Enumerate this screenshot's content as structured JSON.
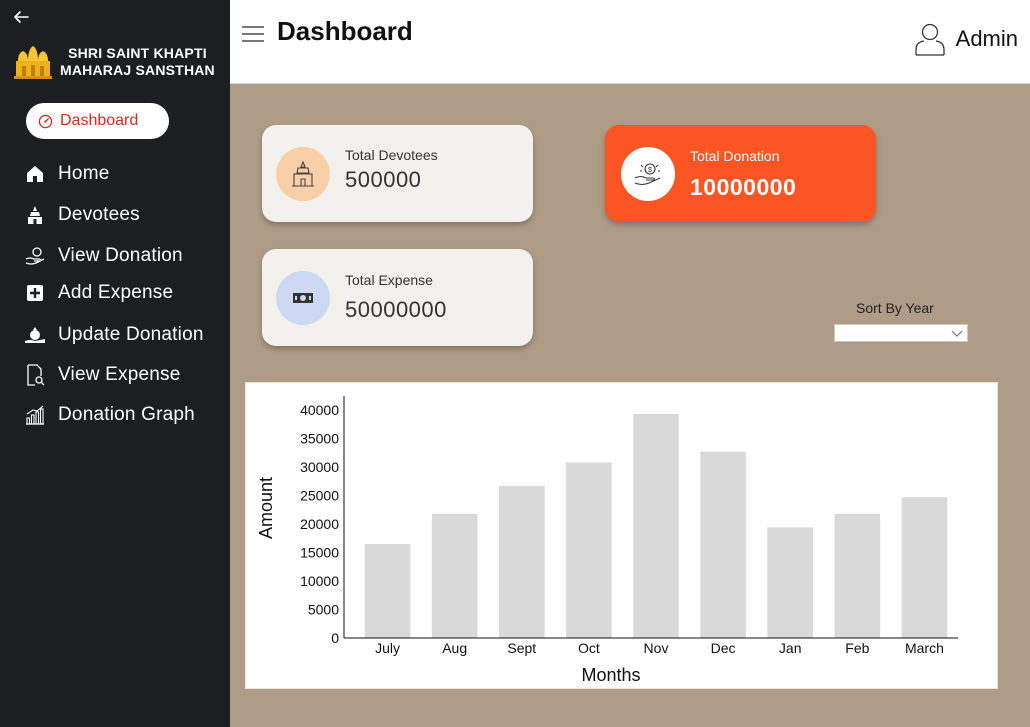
{
  "sidebar": {
    "brand_line1": "SHRI SAINT KHAPTI",
    "brand_line2": "MAHARAJ SANSTHAN",
    "active_label": "Dashboard",
    "items": [
      {
        "label": "Home",
        "icon": "home-icon"
      },
      {
        "label": "Devotees",
        "icon": "temple-icon"
      },
      {
        "label": "View Donation",
        "icon": "hand-coin-icon"
      },
      {
        "label": "Add Expense",
        "icon": "plus-box-icon"
      },
      {
        "label": "Update Donation",
        "icon": "money-bag-icon"
      },
      {
        "label": "View Expense",
        "icon": "document-search-icon"
      },
      {
        "label": "Donation Graph",
        "icon": "bar-chart-icon"
      }
    ]
  },
  "header": {
    "title": "Dashboard",
    "user_label": "Admin"
  },
  "cards": {
    "devotees": {
      "label": "Total Devotees",
      "value": "500000"
    },
    "donation": {
      "label": "Total Donation",
      "value": "10000000"
    },
    "expense": {
      "label": "Total Expense",
      "value": "50000000"
    }
  },
  "sort": {
    "label": "Sort By Year",
    "selected": ""
  },
  "colors": {
    "sidebar_bg": "#1c1e20",
    "page_bg": "#ae9c86",
    "accent_orange": "#fa5522",
    "active_red": "#d62a1c",
    "bar_fill": "#d9d9d9"
  },
  "chart_data": {
    "type": "bar",
    "categories": [
      "July",
      "Aug",
      "Sept",
      "Oct",
      "Nov",
      "Dec",
      "Jan",
      "Feb",
      "March"
    ],
    "values": [
      16500,
      21800,
      26700,
      30800,
      39300,
      32700,
      19400,
      21800,
      24700
    ],
    "xlabel": "Months",
    "ylabel": "Amount",
    "ylim": [
      0,
      40000
    ],
    "yticks": [
      0,
      5000,
      10000,
      15000,
      20000,
      25000,
      30000,
      35000,
      40000
    ],
    "grid": false,
    "legend": "none"
  }
}
